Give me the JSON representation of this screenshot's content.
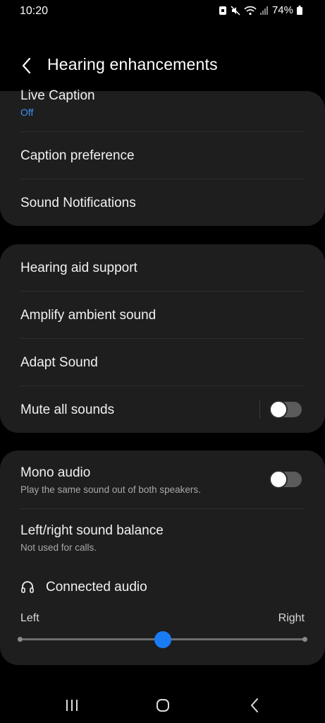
{
  "status_bar": {
    "time": "10:20",
    "battery": "74%",
    "icons": [
      "notification-icon",
      "mute-icon",
      "wifi-icon",
      "signal-icon",
      "battery-icon"
    ]
  },
  "header": {
    "title": "Hearing enhancements",
    "back_icon": "back-arrow-icon"
  },
  "group1": {
    "live_caption": {
      "label": "Live Caption",
      "value": "Off"
    },
    "caption_preference": "Caption preference",
    "sound_notifications": "Sound Notifications"
  },
  "group2": {
    "hearing_aid_support": "Hearing aid support",
    "amplify_ambient_sound": "Amplify ambient sound",
    "adapt_sound": "Adapt Sound",
    "mute_all_sounds": {
      "label": "Mute all sounds",
      "enabled": false
    }
  },
  "group3": {
    "mono_audio": {
      "label": "Mono audio",
      "description": "Play the same sound out of both speakers.",
      "enabled": false
    },
    "balance": {
      "label": "Left/right sound balance",
      "description": "Not used for calls.",
      "device_label": "Connected audio",
      "device_icon": "headphones-icon",
      "left_label": "Left",
      "right_label": "Right",
      "value": 0.5
    }
  },
  "nav": {
    "recents_icon": "recents-icon",
    "home_icon": "home-icon",
    "back_icon": "nav-back-icon"
  },
  "colors": {
    "background": "#000000",
    "card": "#1e1e1e",
    "accent": "#1a7cf5",
    "link_blue": "#3e91f7"
  }
}
